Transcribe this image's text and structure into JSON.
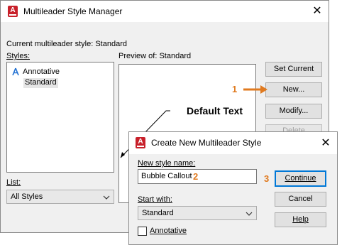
{
  "main_dialog": {
    "title": "Multileader Style Manager",
    "current_style_label": "Current multileader style: Standard",
    "styles_label": "Styles:",
    "styles": [
      {
        "name": "Annotative",
        "annotative": true
      },
      {
        "name": "Standard",
        "annotative": false,
        "selected": true
      }
    ],
    "preview_label": "Preview of: Standard",
    "list_label": "List:",
    "list_value": "All Styles",
    "buttons": {
      "set_current": "Set Current",
      "new": "New...",
      "modify": "Modify...",
      "delete": "Delete"
    }
  },
  "callout": {
    "default_text": "Default Text",
    "step1": "1",
    "step2": "2",
    "step3": "3",
    "accent_color": "#e07a1f"
  },
  "new_dialog": {
    "title": "Create New Multileader Style",
    "new_style_name_label": "New style name:",
    "new_style_name_value": "Bubble Callout",
    "start_with_label": "Start with:",
    "start_with_value": "Standard",
    "annotative_label": "Annotative",
    "annotative_checked": false,
    "buttons": {
      "continue": "Continue",
      "cancel": "Cancel",
      "help": "Help"
    }
  }
}
